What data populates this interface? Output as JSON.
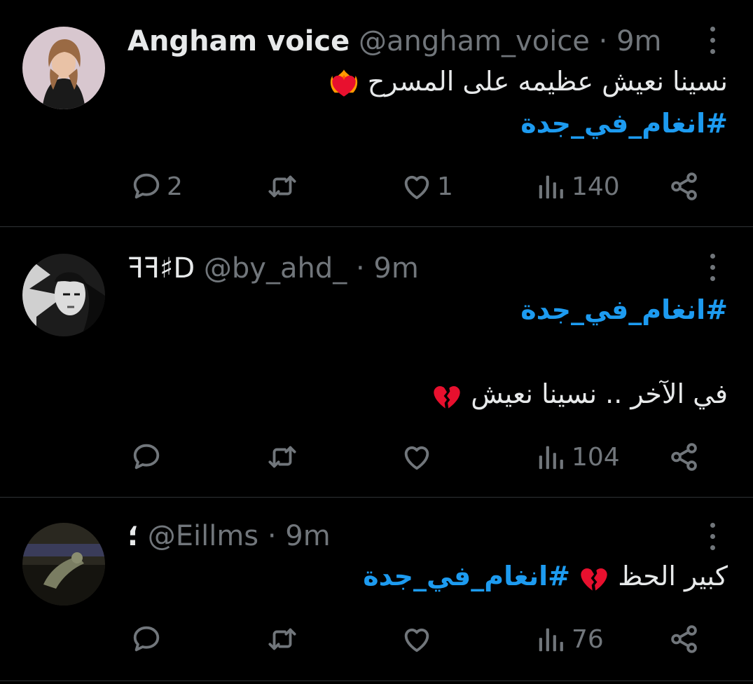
{
  "tweets": [
    {
      "name": "Angham voice",
      "handle": "@angham_voice",
      "separator": "·",
      "time": "9m",
      "line1": "نسينا نعيش عظيمه على المسرح",
      "line1_emoji": "heart-on-fire-emoji",
      "line2_hashtag": "#انغام_في_جدة",
      "counts": {
        "reply": "2",
        "retweet": "",
        "like": "1",
        "views": "140"
      }
    },
    {
      "name": "ꟻꟻ♯D",
      "handle": "@by_ahd_",
      "separator": "·",
      "time": "9m",
      "line1_hashtag": "#انغام_في_جدة",
      "line2": "في الآخر .. نسينا نعيش",
      "line2_emoji": "broken-heart-emoji",
      "counts": {
        "reply": "",
        "retweet": "",
        "like": "",
        "views": "104"
      }
    },
    {
      "name": "؛",
      "handle": "@Eillms",
      "separator": "·",
      "time": "9m",
      "line1_text": "كبير الحظ",
      "line1_hashtag": "#انغام_في_جدة",
      "line1_emoji": "broken-heart-emoji",
      "counts": {
        "reply": "",
        "retweet": "",
        "like": "",
        "views": "76"
      }
    }
  ],
  "colors": {
    "background": "#000000",
    "text": "#e7e9ea",
    "muted": "#71767b",
    "link": "#1d9bf0",
    "divider": "#2f3336"
  },
  "icons": [
    "reply-icon",
    "retweet-icon",
    "like-icon",
    "views-icon",
    "share-icon",
    "more-icon"
  ]
}
